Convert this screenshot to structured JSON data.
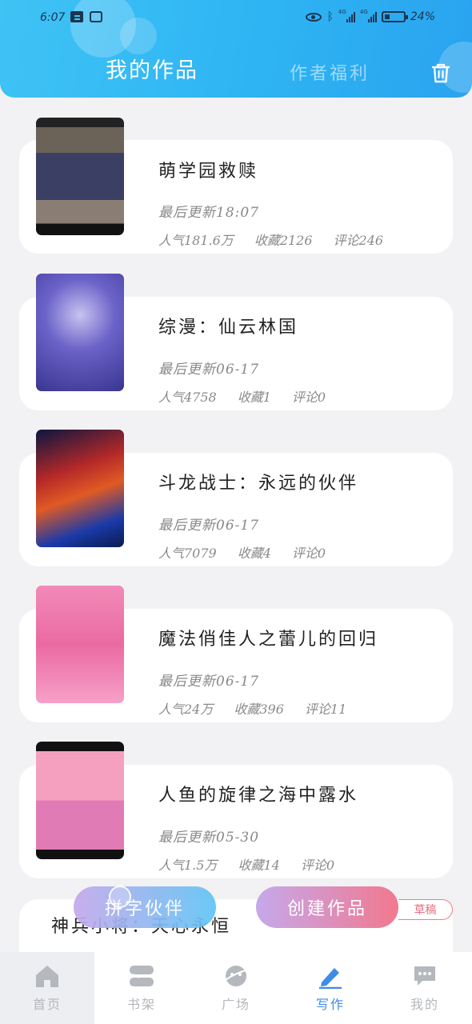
{
  "status_bar": {
    "time": "6:07",
    "network1": "4G",
    "network2": "4G",
    "battery": "24%"
  },
  "header": {
    "tab_active": "我的作品",
    "tab_inactive": "作者福利"
  },
  "works": [
    {
      "title": "萌学园救赎",
      "last_update": "最后更新18:07",
      "popularity": "人气181.6万",
      "favorites": "收藏2126",
      "comments": "评论246"
    },
    {
      "title": "综漫：仙云林国",
      "last_update": "最后更新06-17",
      "popularity": "人气4758",
      "favorites": "收藏1",
      "comments": "评论0"
    },
    {
      "title": "斗龙战士：永远的伙伴",
      "last_update": "最后更新06-17",
      "popularity": "人气7079",
      "favorites": "收藏4",
      "comments": "评论0"
    },
    {
      "title": "魔法俏佳人之蕾儿的回归",
      "last_update": "最后更新06-17",
      "popularity": "人气24万",
      "favorites": "收藏396",
      "comments": "评论11"
    },
    {
      "title": "人鱼的旋律之海中露水",
      "last_update": "最后更新05-30",
      "popularity": "人气1.5万",
      "favorites": "收藏14",
      "comments": "评论0"
    },
    {
      "title": "神兵小将：天心永恒"
    }
  ],
  "actions": {
    "partner": "拼字伙伴",
    "create": "创建作品",
    "draft": "草稿"
  },
  "bottom_nav": [
    {
      "label": "首页",
      "icon": "home-icon"
    },
    {
      "label": "书架",
      "icon": "bookshelf-icon"
    },
    {
      "label": "广场",
      "icon": "planet-icon"
    },
    {
      "label": "写作",
      "icon": "pen-icon",
      "active": true
    },
    {
      "label": "我的",
      "icon": "chat-icon"
    }
  ],
  "colors": {
    "header": "#2eb4f3",
    "active_nav": "#3d8ce6",
    "create_btn_end": "#f2788e",
    "draft_tag": "#ee6e7c"
  }
}
